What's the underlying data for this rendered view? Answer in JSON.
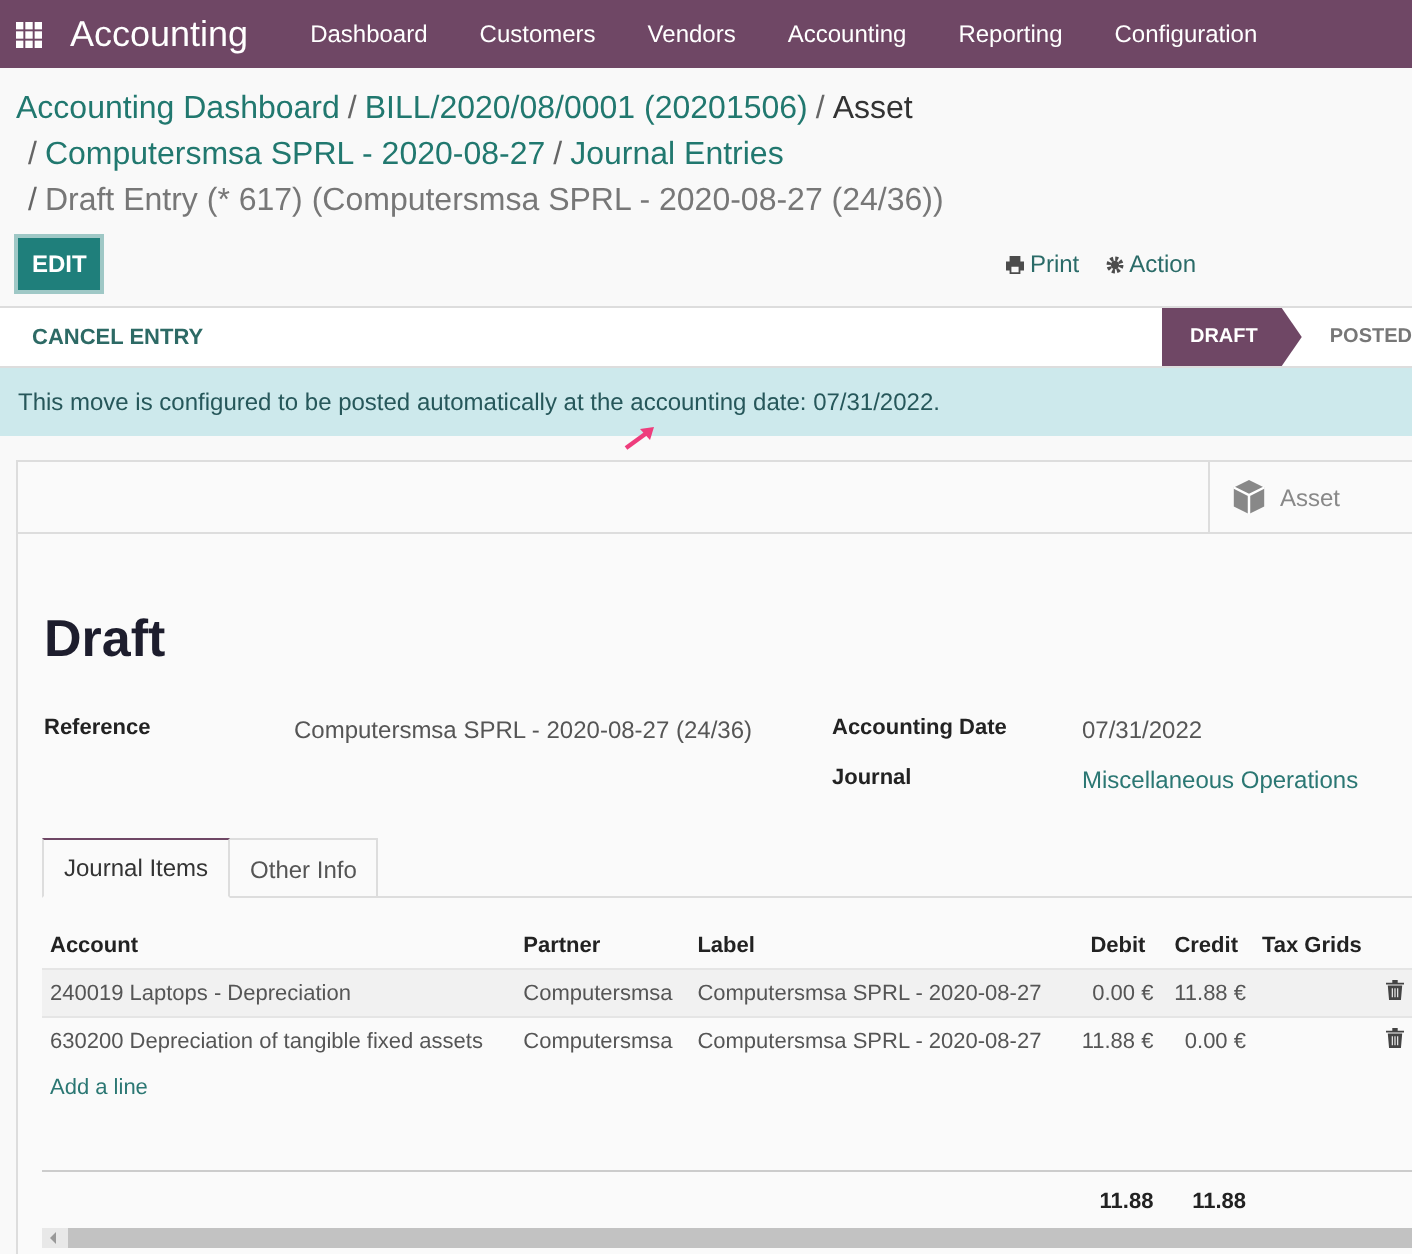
{
  "navbar": {
    "app_name": "Accounting",
    "menu": [
      "Dashboard",
      "Customers",
      "Vendors",
      "Accounting",
      "Reporting",
      "Configuration"
    ]
  },
  "breadcrumb": {
    "lines": [
      [
        {
          "text": "Accounting Dashboard",
          "kind": "link"
        },
        {
          "separator": "/",
          "text": "BILL/2020/08/0001 (20201506)",
          "kind": "link"
        },
        {
          "separator": "/",
          "text": "Asset",
          "kind": "hover"
        }
      ],
      [
        {
          "separator": "/",
          "text": "Computersmsa SPRL - 2020-08-27",
          "kind": "link"
        },
        {
          "separator": "/",
          "text": "Journal Entries",
          "kind": "link"
        }
      ],
      [
        {
          "separator": "/",
          "text": "Draft Entry (* 617) (Computersmsa SPRL - 2020-08-27 (24/36))",
          "kind": "current"
        }
      ]
    ]
  },
  "toolbar": {
    "edit": "EDIT",
    "print": "Print",
    "action": "Action"
  },
  "statusbar": {
    "button": "CANCEL ENTRY",
    "stages": [
      {
        "label": "DRAFT",
        "selected": true
      },
      {
        "label": "POSTED",
        "selected": false
      }
    ]
  },
  "alert": "This move is configured to be posted automatically at the accounting date: 07/31/2022.",
  "button_box": {
    "asset": "Asset"
  },
  "title": "Draft",
  "fields_left": [
    {
      "label": "Reference",
      "value": "Computersmsa SPRL - 2020-08-27 (24/36)",
      "kind": "text"
    }
  ],
  "fields_right": [
    {
      "label": "Accounting Date",
      "value": "07/31/2022",
      "kind": "text"
    },
    {
      "label": "Journal",
      "value": "Miscellaneous Operations",
      "kind": "link"
    }
  ],
  "tabs": [
    {
      "label": "Journal Items",
      "selected": true
    },
    {
      "label": "Other Info",
      "selected": false
    }
  ],
  "table": {
    "columns": [
      "Account",
      "Partner",
      "Label",
      "Debit",
      "Credit",
      "Tax Grids"
    ],
    "rows": [
      [
        "240019 Laptops - Depreciation",
        "Computersmsa",
        "Computersmsa SPRL  - 2020-08-27",
        "0.00 €",
        "11.88 €",
        ""
      ],
      [
        "630200 Depreciation of tangible fixed assets",
        "Computersmsa",
        "Computersmsa SPRL  - 2020-08-27",
        "11.88 €",
        "0.00 €",
        ""
      ]
    ],
    "add_line": "Add a line",
    "totals": {
      "debit": "11.88",
      "credit": "11.88"
    }
  }
}
